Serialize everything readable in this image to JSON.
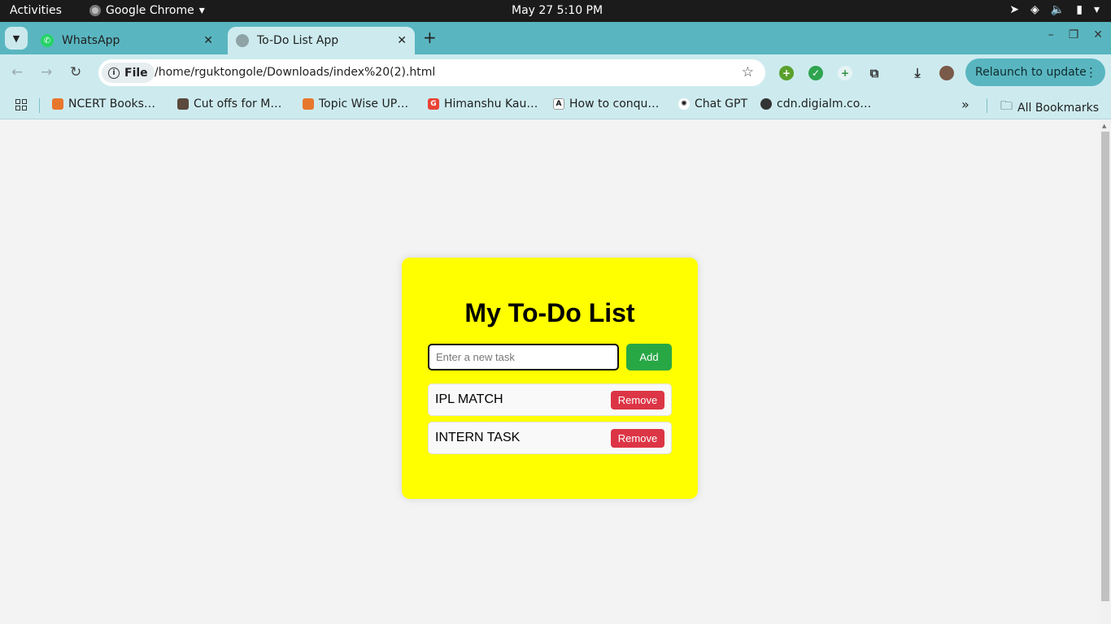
{
  "system_bar": {
    "activities": "Activities",
    "app_name": "Google Chrome",
    "clock": "May 27  5:10 PM"
  },
  "tabs": [
    {
      "title": "WhatsApp",
      "active": false,
      "icon": "whatsapp-icon"
    },
    {
      "title": "To-Do List App",
      "active": true,
      "icon": "globe-icon"
    }
  ],
  "toolbar": {
    "site_chip": "File",
    "url": "/home/rguktongole/Downloads/index%20(2).html",
    "relaunch_label": "Relaunch to update"
  },
  "bookmarks": [
    {
      "label": "NCERT Books…",
      "icon": "ncert-icon"
    },
    {
      "label": "Cut offs for M…",
      "icon": "image-icon"
    },
    {
      "label": "Topic Wise UP…",
      "icon": "ncert-icon"
    },
    {
      "label": "Himanshu Kau…",
      "icon": "google-icon"
    },
    {
      "label": "How to conqu…",
      "icon": "ad-icon"
    },
    {
      "label": "Chat GPT",
      "icon": "chatgpt-icon"
    },
    {
      "label": "cdn.digialm.co…",
      "icon": "globe-icon"
    }
  ],
  "all_bookmarks": "All Bookmarks",
  "app": {
    "title": "My To-Do List",
    "input_placeholder": "Enter a new task",
    "input_value": "",
    "add_label": "Add",
    "tasks": [
      {
        "text": "IPL MATCH",
        "remove_label": "Remove"
      },
      {
        "text": "INTERN TASK",
        "remove_label": "Remove"
      }
    ]
  },
  "colors": {
    "card_bg": "#ffff00",
    "add_button": "#28a745",
    "remove_button": "#dc3545",
    "chrome_accent": "#59b6c0"
  }
}
